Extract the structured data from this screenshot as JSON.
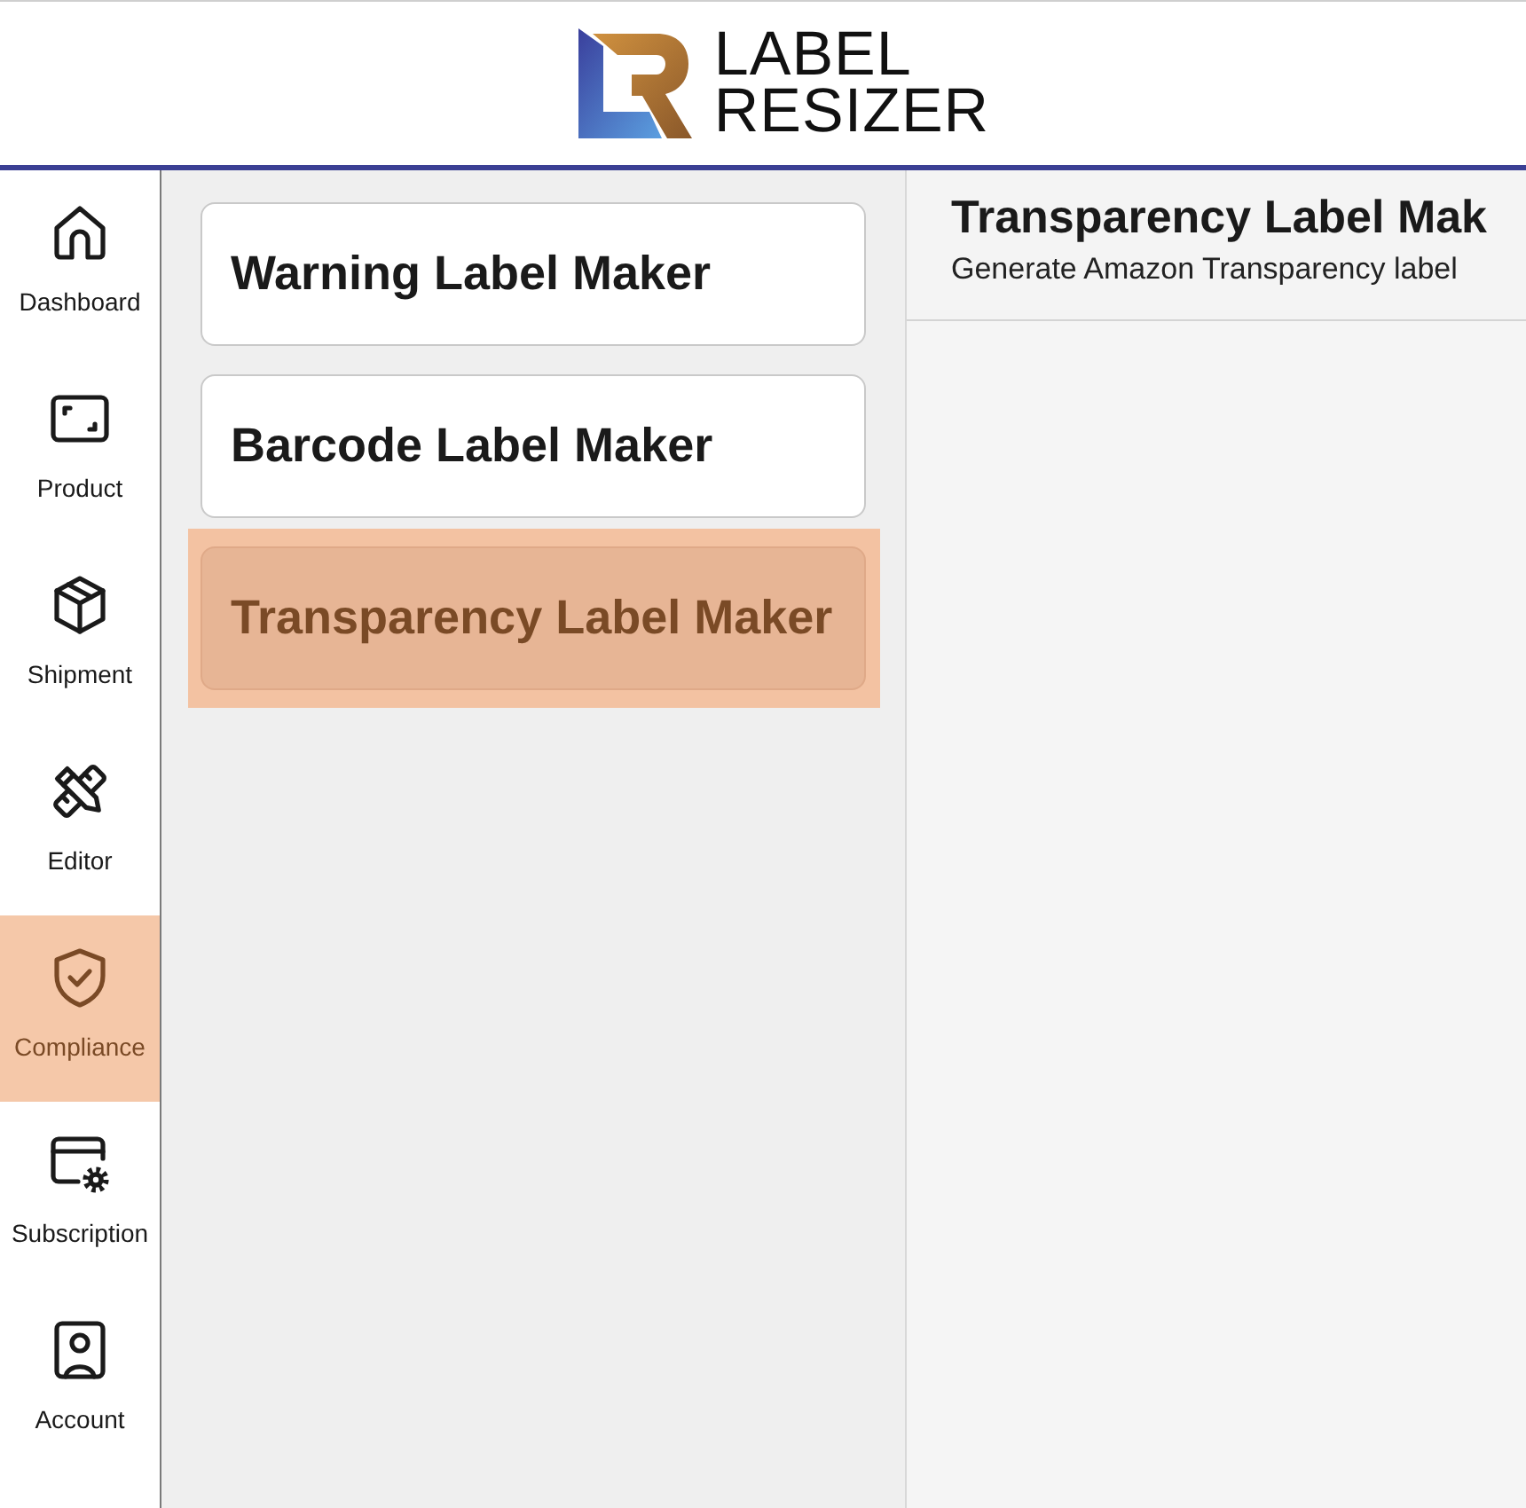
{
  "header": {
    "logo_text": [
      "LABEL",
      "RESIZER"
    ]
  },
  "nav": [
    {
      "label": "Dashboard",
      "selected": false
    },
    {
      "label": "Product",
      "selected": false
    },
    {
      "label": "Shipment",
      "selected": false
    },
    {
      "label": "Editor",
      "selected": false
    },
    {
      "label": "Compliance",
      "selected": true
    },
    {
      "label": "Subscription",
      "selected": false
    },
    {
      "label": "Account",
      "selected": false
    }
  ],
  "tools": [
    {
      "label": "Warning Label Maker",
      "selected": false
    },
    {
      "label": "Barcode Label Maker",
      "selected": false
    },
    {
      "label": "Transparency Label Maker",
      "selected": true
    }
  ],
  "page": {
    "title": "Transparency Label Mak",
    "subtitle": "Generate Amazon Transparency label"
  }
}
